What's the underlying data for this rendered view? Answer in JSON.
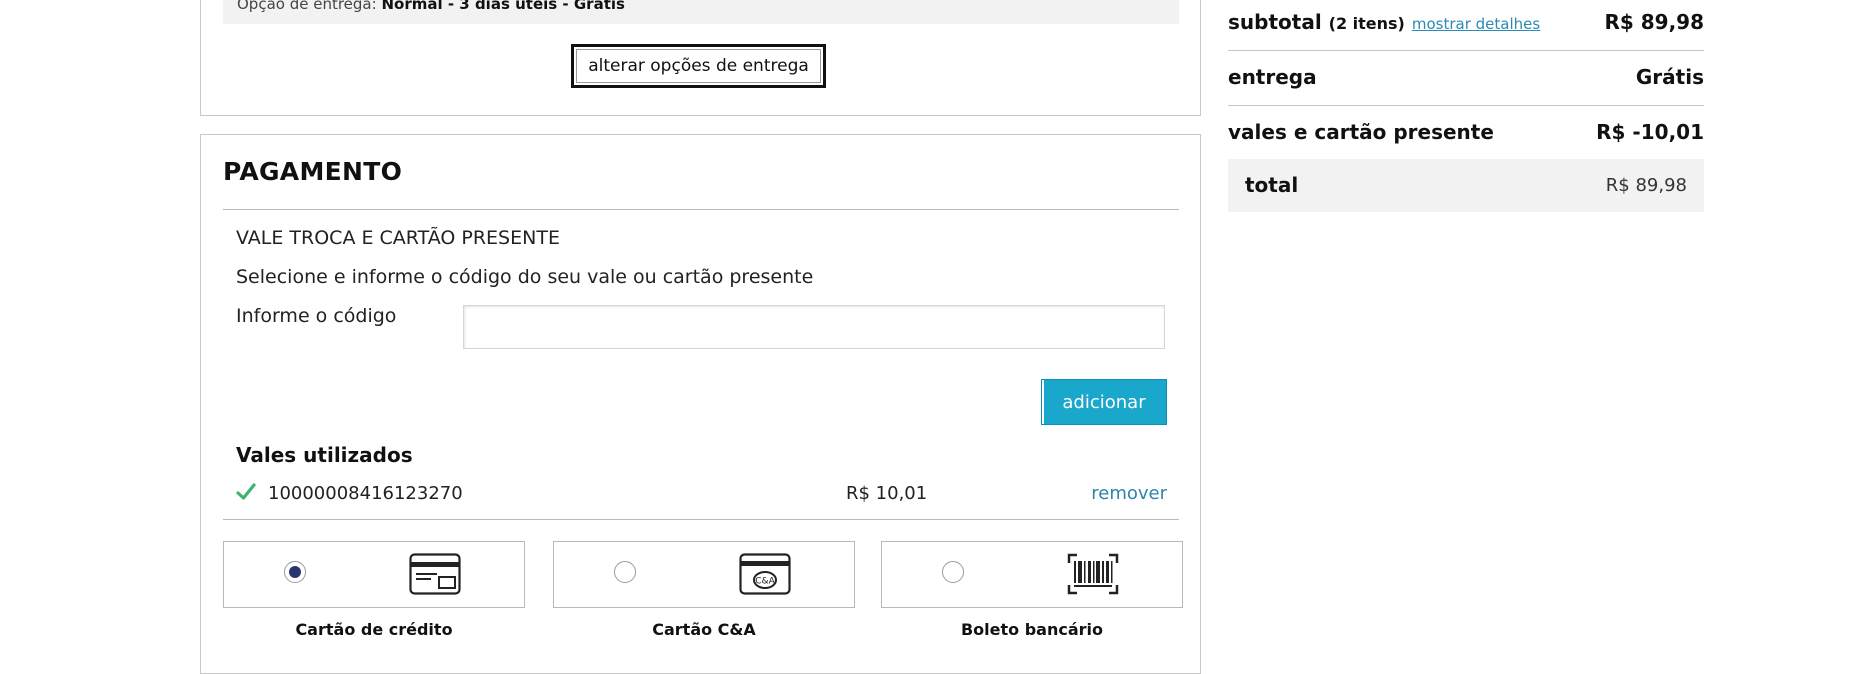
{
  "delivery": {
    "option_label": "Opção de entrega:",
    "option_value": "Normal - 3 dias úteis - Grátis",
    "change_button": "alterar opções de entrega"
  },
  "payment": {
    "title": "PAGAMENTO",
    "voucher_heading": "VALE TROCA E CARTÃO PRESENTE",
    "voucher_description": "Selecione e informe o código do seu vale ou cartão presente",
    "code_label": "Informe o código",
    "code_value": "",
    "add_button": "adicionar",
    "used_title": "Vales utilizados",
    "used_vouchers": [
      {
        "code": "10000008416123270",
        "value": "R$ 10,01",
        "remove": "remover"
      }
    ],
    "methods": [
      {
        "label": "Cartão de crédito",
        "selected": true,
        "icon": "credit-card-icon"
      },
      {
        "label": "Cartão C&A",
        "selected": false,
        "icon": "ca-card-icon"
      },
      {
        "label": "Boleto bancário",
        "selected": false,
        "icon": "barcode-icon"
      }
    ]
  },
  "summary": {
    "subtotal_label": "subtotal",
    "subtotal_count": "(2 itens)",
    "details_link": "mostrar detalhes",
    "subtotal_value": "R$ 89,98",
    "delivery_label": "entrega",
    "delivery_value": "Grátis",
    "vouchers_label": "vales e cartão presente",
    "vouchers_value": "R$ -10,01",
    "total_label": "total",
    "total_value": "R$ 89,98"
  },
  "colors": {
    "accent": "#1aa7cc",
    "link": "#2f83a8",
    "radio_selected": "#2c3470",
    "check": "#3cb371"
  }
}
